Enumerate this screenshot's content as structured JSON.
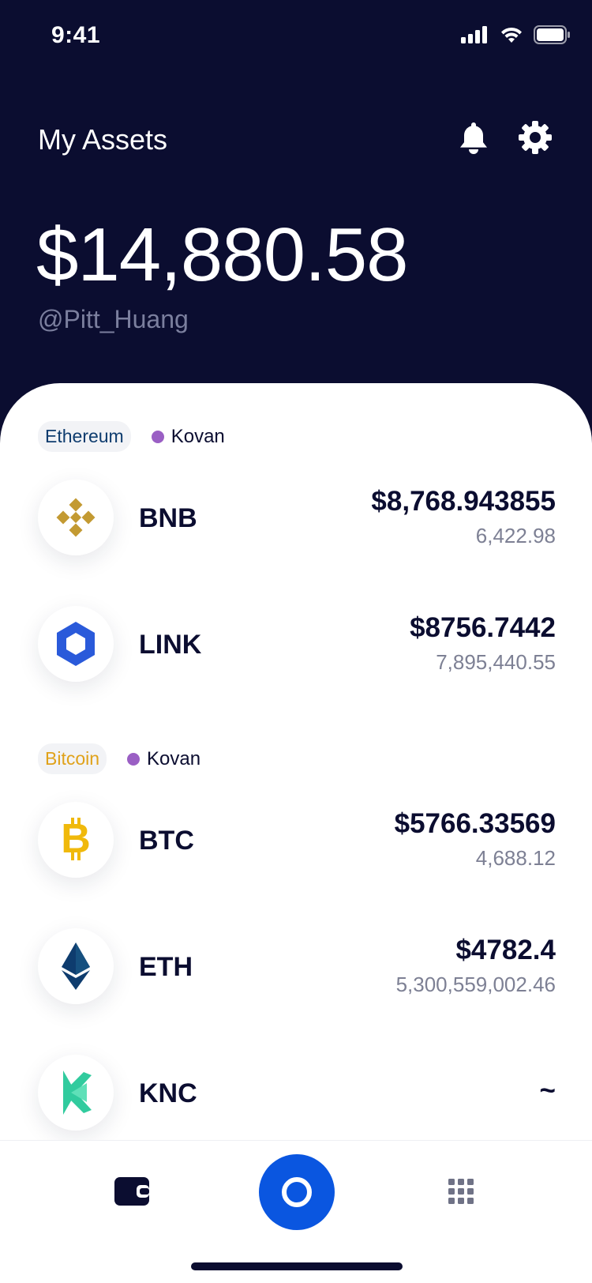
{
  "status_bar": {
    "time": "9:41"
  },
  "header": {
    "title": "My Assets",
    "bell_icon": "bell-icon",
    "settings_icon": "gear-icon"
  },
  "balance": {
    "amount": "$14,880.58",
    "handle": "@Pitt_Huang"
  },
  "groups": [
    {
      "chain": "Ethereum",
      "network": "Kovan",
      "assets": [
        {
          "symbol": "BNB",
          "value": "$8,768.943855",
          "amount": "6,422.98"
        },
        {
          "symbol": "LINK",
          "value": "$8756.7442",
          "amount": "7,895,440.55"
        }
      ]
    },
    {
      "chain": "Bitcoin",
      "network": "Kovan",
      "assets": [
        {
          "symbol": "BTC",
          "value": "$5766.33569",
          "amount": "4,688.12"
        },
        {
          "symbol": "ETH",
          "value": "$4782.4",
          "amount": "5,300,559,002.46"
        },
        {
          "symbol": "KNC",
          "value": "~",
          "amount": ""
        }
      ]
    }
  ],
  "colors": {
    "background": "#0b0d30",
    "accent": "#0a56e0",
    "network_dot": "#9a5fc4",
    "bitcoin_chip": "#e0a21a",
    "ethereum_chip": "#0e3c6e"
  },
  "tabbar": {
    "left_icon": "wallet-icon",
    "center_icon": "circle-icon",
    "right_icon": "apps-grid-icon"
  }
}
